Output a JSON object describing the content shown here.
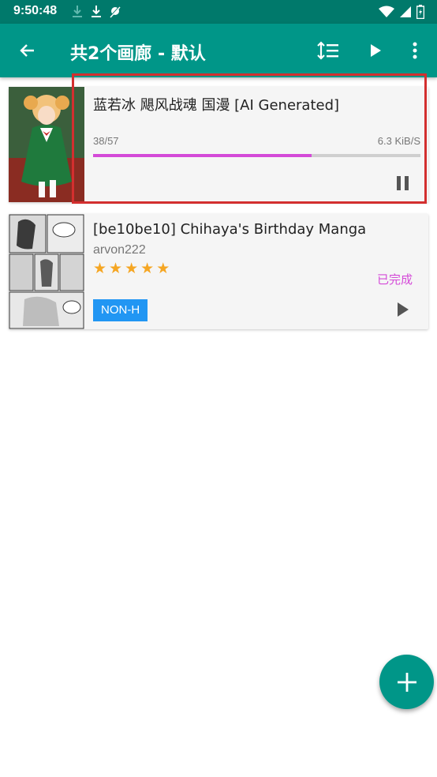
{
  "status_bar": {
    "time": "9:50:48",
    "icons_left": [
      "download-done-icon",
      "download-icon",
      "no-location-icon"
    ],
    "icons_right": [
      "wifi-icon",
      "signal-icon",
      "battery-icon"
    ]
  },
  "app_bar": {
    "title": "共2个画廊 - 默认",
    "actions": [
      "sort-icon",
      "play-icon",
      "more-vert-icon"
    ],
    "color": "#009688"
  },
  "downloads": [
    {
      "title": "蓝若冰 飓风战魂 国漫 [AI Generated]",
      "progress_text": "38/57",
      "progress": 0.667,
      "speed": "6.3 KiB/S",
      "action": "pause"
    },
    {
      "title": "[be10be10] Chihaya's Birthday Manga",
      "uploader": "arvon222",
      "rating": 5,
      "status": "已完成",
      "tag": "NON-H",
      "action": "play"
    }
  ],
  "fab": {
    "icon": "plus-icon"
  },
  "colors": {
    "accent": "#d44ad8",
    "tag": "#2196f3",
    "star": "#f5a623",
    "highlight": "#d32f2f"
  }
}
